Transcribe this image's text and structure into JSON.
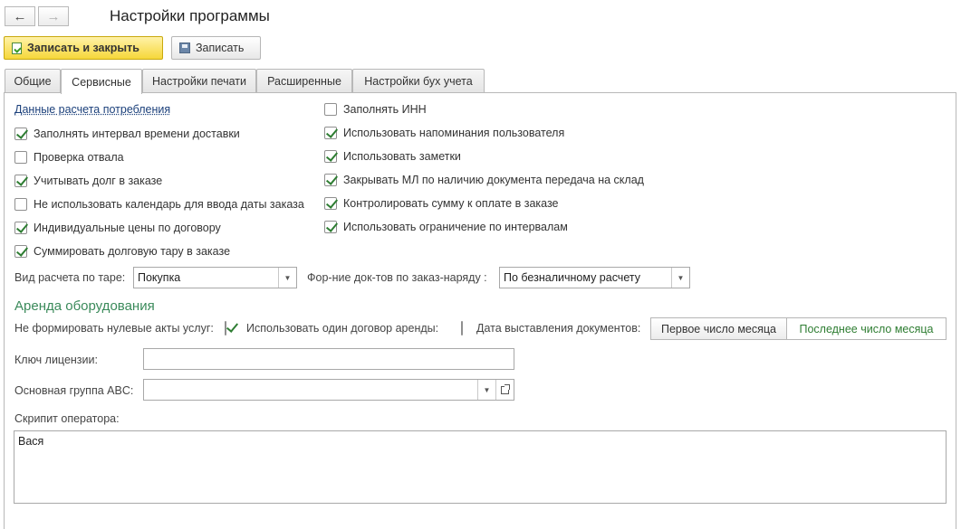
{
  "header": {
    "title": "Настройки программы",
    "back_icon": "arrow-left-icon",
    "forward_icon": "arrow-right-icon"
  },
  "toolbar": {
    "save_close_label": "Записать и закрыть",
    "save_label": "Записать"
  },
  "tabs": [
    {
      "label": "Общие",
      "active": false
    },
    {
      "label": "Сервисные",
      "active": true
    },
    {
      "label": "Настройки печати",
      "active": false
    },
    {
      "label": "Расширенные",
      "active": false
    },
    {
      "label": "Настройки бух учета",
      "active": false
    }
  ],
  "service": {
    "link_consumption": "Данные расчета потребления",
    "left_checks": [
      {
        "label": "Заполнять интервал времени доставки",
        "checked": true
      },
      {
        "label": "Проверка отвала",
        "checked": false
      },
      {
        "label": "Учитывать долг в заказе",
        "checked": true
      },
      {
        "label": "Не использовать календарь для ввода даты заказа",
        "checked": false
      },
      {
        "label": "Индивидуальные цены по договору",
        "checked": true
      },
      {
        "label": "Суммировать долговую тару в заказе",
        "checked": true
      }
    ],
    "right_checks": [
      {
        "label": "Заполнять ИНН",
        "checked": false
      },
      {
        "label": "Использовать напоминания пользователя",
        "checked": true
      },
      {
        "label": "Использовать заметки",
        "checked": true
      },
      {
        "label": "Закрывать МЛ по наличию документа передача на склад",
        "checked": true
      },
      {
        "label": "Контролировать сумму к оплате в заказе",
        "checked": true
      },
      {
        "label": "Использовать ограничение по интервалам",
        "checked": true
      }
    ],
    "tare_calc_label": "Вид расчета по таре:",
    "tare_calc_value": "Покупка",
    "docs_label": "Фор-ние док-тов по заказ-наряду :",
    "docs_value": "По безналичному расчету"
  },
  "rental": {
    "title": "Аренда оборудования",
    "no_zero_acts_label": "Не формировать нулевые акты услуг:",
    "no_zero_acts_checked": true,
    "one_contract_label": "Использовать один договор аренды:",
    "one_contract_checked": false,
    "doc_date_label": "Дата выставления документов:",
    "doc_date_options": [
      "Первое число месяца",
      "Последнее число месяца"
    ],
    "doc_date_selected": "Последнее число месяца"
  },
  "license": {
    "key_label": "Ключ лицензии:",
    "key_value": "",
    "abc_label": "Основная группа ABC:",
    "abc_value": ""
  },
  "script": {
    "label": "Скрипит оператора:",
    "value": "Вася"
  },
  "colors": {
    "primary_button": "#f6d73a",
    "check": "#2e7d32",
    "section_title": "#3a8a5a",
    "link": "#1a3f7a"
  }
}
